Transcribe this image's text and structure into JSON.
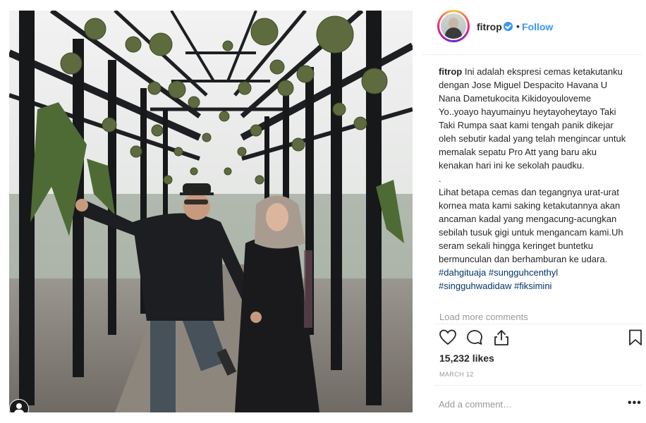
{
  "post": {
    "username": "fitrop",
    "dot": "•",
    "follow_label": "Follow",
    "caption_username": "fitrop",
    "caption_line1": "Ini adalah ekspresi cemas ketakutanku dengan Jose Miguel Despacito Havana U Nana Dametukocita Kikidoyouloveme Yo..yoayo hayumainyu heytayoheytayo Taki Taki Rumpa saat kami tengah panik dikejar oleh sebutir kadal yang telah mengincar untuk memalak sepatu Pro Att yang baru aku kenakan hari ini ke sekolah paudku.",
    "caption_dot": ".",
    "caption_line2": "Lihat betapa cemas dan tegangnya urat-urat kornea mata kami saking ketakutannya akan ancaman kadal yang mengacung-acungkan sebilah tusuk gigi untuk mengancam kami.Uh seram sekali hingga keringet buntetku bermunculan dan berhamburan ke udara.",
    "hashtags": [
      "#dahgituaja",
      "#sungguhcenthyl",
      "#singguhwadidaw",
      "#fiksimini"
    ],
    "load_more": "Load more comments",
    "likes": "15,232 likes",
    "date": "MARCH 12",
    "comment_placeholder": "Add a comment…",
    "more_label": "•••"
  },
  "icons": [
    "heart-icon",
    "comment-icon",
    "share-icon",
    "bookmark-icon",
    "user-tag-icon",
    "verified-icon",
    "more-options-icon"
  ],
  "colors": {
    "link": "#3897f0",
    "hashtag": "#003569",
    "muted": "#999999",
    "text": "#262626"
  }
}
